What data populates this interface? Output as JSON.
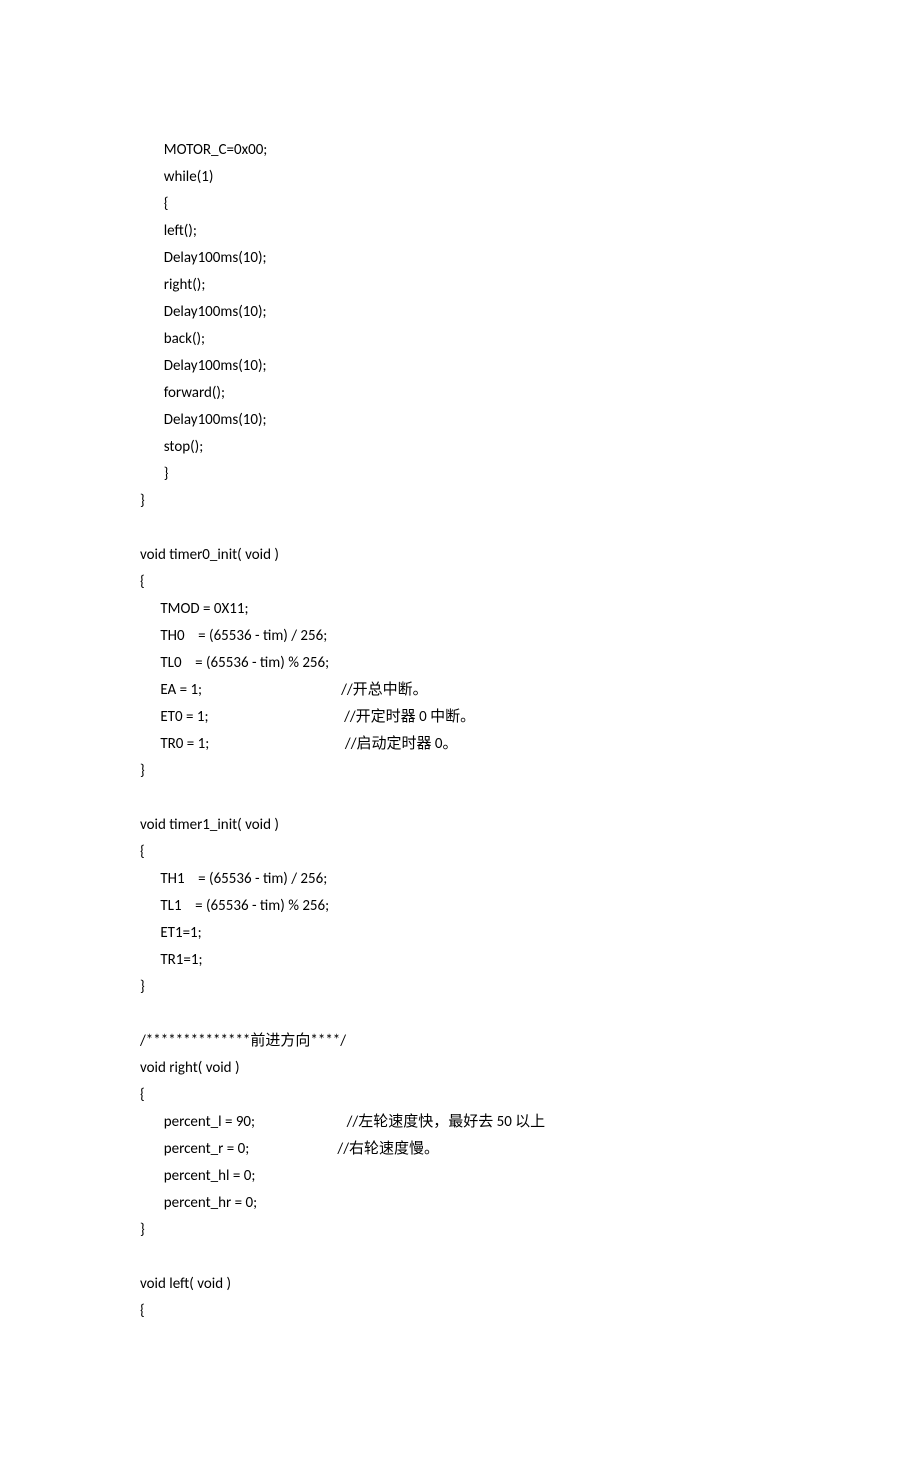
{
  "code_lines": [
    "       MOTOR_C=0x00;",
    "       while(1)",
    "       {",
    "       left();",
    "       Delay100ms(10);",
    "       right();",
    "       Delay100ms(10);",
    "       back();",
    "       Delay100ms(10);",
    "       forward();",
    "       Delay100ms(10);",
    "       stop();",
    "       }",
    "}",
    "",
    "void timer0_init( void )",
    "{",
    "      TMOD = 0X11;",
    "      TH0    = (65536 - tim) / 256;",
    "      TL0    = (65536 - tim) % 256;",
    "      EA = 1;                                         //开总中断。",
    "      ET0 = 1;                                        //开定时器 0 中断。",
    "      TR0 = 1;                                        //启动定时器 0。",
    "}",
    "",
    "void timer1_init( void )",
    "{",
    "      TH1    = (65536 - tim) / 256;",
    "      TL1    = (65536 - tim) % 256;",
    "      ET1=1;",
    "      TR1=1;",
    "}",
    "",
    "/**************前进方向****/",
    "void right( void )",
    "{",
    "       percent_l = 90;                           //左轮速度快，最好去 50 以上",
    "       percent_r = 0;                          //右轮速度慢。",
    "       percent_hl = 0;",
    "       percent_hr = 0;",
    "}",
    "",
    "void left( void )",
    "{"
  ]
}
